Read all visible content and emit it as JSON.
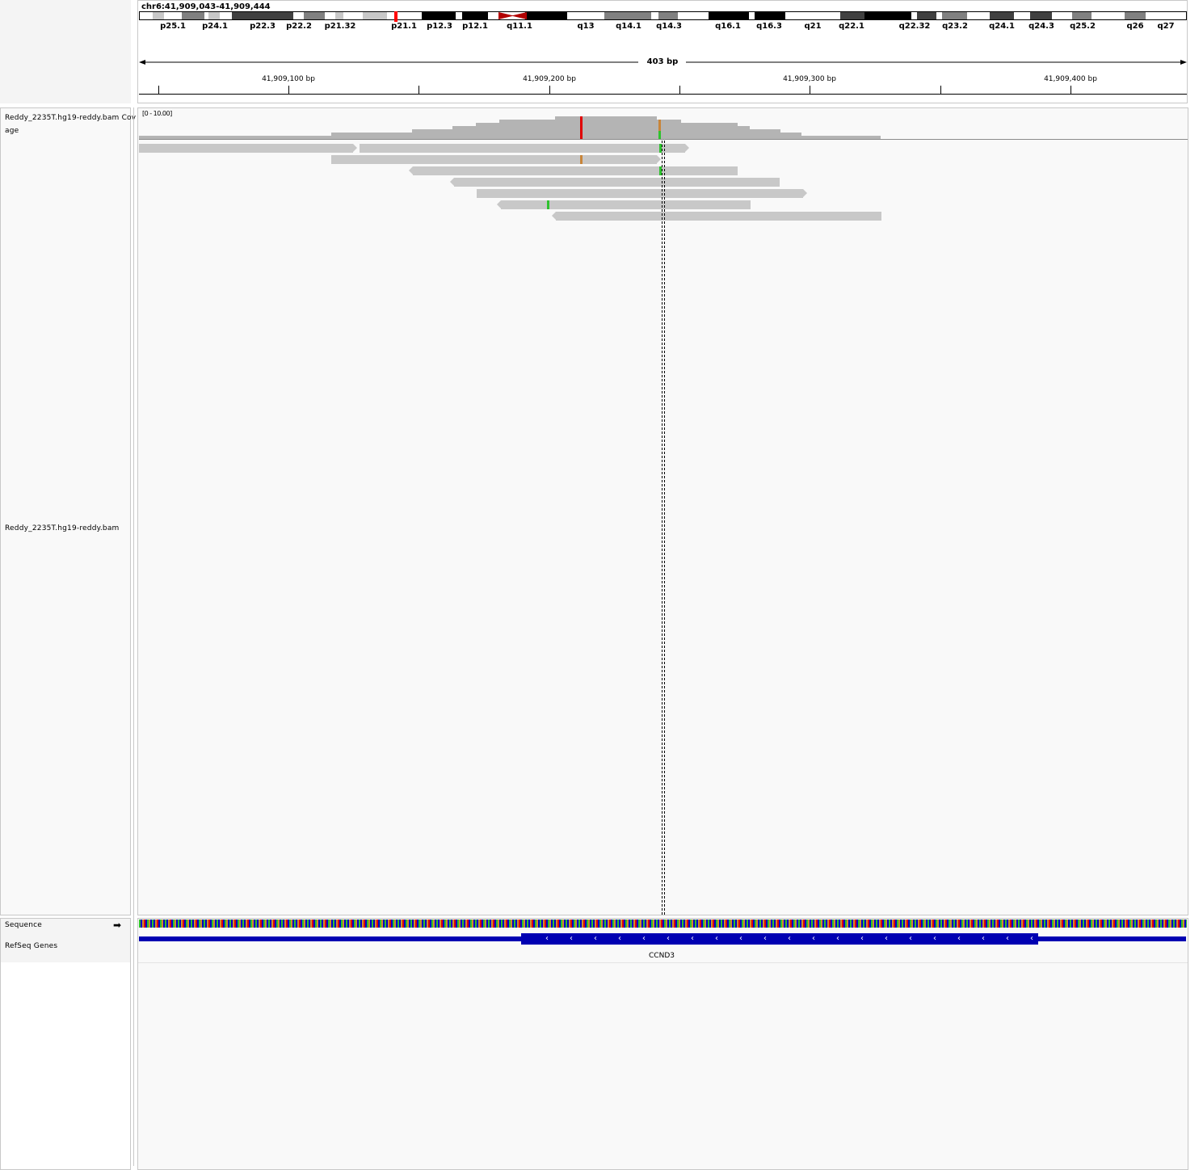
{
  "locus": "chr6:41,909,043-41,909,444",
  "ideogram": {
    "band_labels": [
      "p25.1",
      "p24.1",
      "p22.3",
      "p22.2",
      "p21.32",
      "p21.1",
      "p12.3",
      "p12.1",
      "q11.1",
      "q13",
      "q14.1",
      "q14.3",
      "q16.1",
      "q16.3",
      "q21",
      "q22.1",
      "q22.32",
      "q23.2",
      "q24.1",
      "q24.3",
      "q25.2",
      "q26",
      "q27"
    ]
  },
  "ruler": {
    "span_label": "403 bp",
    "ticks": [
      "41,909,100 bp",
      "41,909,200 bp",
      "41,909,300 bp",
      "41,909,400 bp"
    ]
  },
  "tracks": {
    "coverage_name_line1": "Reddy_2235T.hg19-reddy.bam Cov",
    "coverage_name_line2": "age",
    "coverage_range": "[0 - 10.00]",
    "alignment_name": "Reddy_2235T.hg19-reddy.bam",
    "sequence_name": "Sequence",
    "refseq_name": "RefSeq Genes"
  },
  "gene": {
    "name": "CCND3",
    "strand_glyph": "‹"
  },
  "colors": {
    "gene_blue": "#0000b2",
    "read_gray": "#c8c8c8",
    "coverage_gray": "#b4b4b4",
    "mismatch_red": "#e00000",
    "mismatch_orange": "#c8853a",
    "mismatch_green": "#2ec22e",
    "centromere": "#b20000"
  }
}
